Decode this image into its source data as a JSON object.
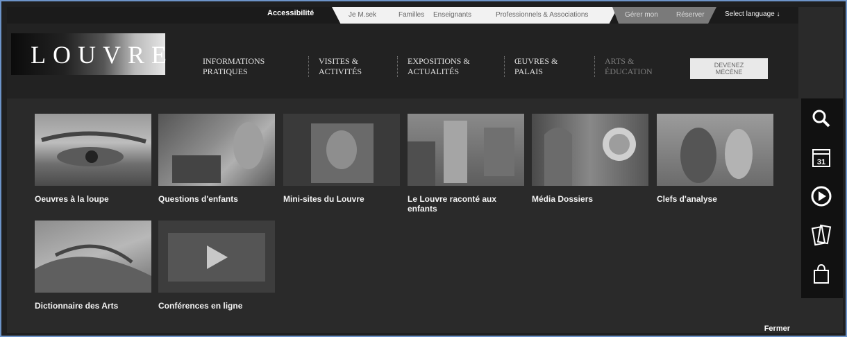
{
  "topbar": {
    "accessibility": "Accessibilité",
    "audiences": [
      "Je M.sek",
      "Familles",
      "Enseignants",
      "Professionnels & Associations"
    ],
    "gray_links": [
      "Gérer mon",
      "Réserver"
    ],
    "language": "Select language ↓"
  },
  "header": {
    "logo": "LOUVRE",
    "nav": [
      {
        "line1": "Informations",
        "line2": "Pratiques"
      },
      {
        "line1": "Visites &",
        "line2": "Activités"
      },
      {
        "line1": "Expositions &",
        "line2": "Actualités"
      },
      {
        "line1": "Œuvres &",
        "line2": "Palais"
      },
      {
        "line1": "Arts &",
        "line2": "Éducation"
      }
    ],
    "donate_line1": "DEVENEZ",
    "donate_line2": "MÉCÈNE"
  },
  "tiles": [
    {
      "caption": "Oeuvres à la loupe"
    },
    {
      "caption": "Questions d'enfants"
    },
    {
      "caption": "Mini-sites du Louvre"
    },
    {
      "caption": "Le Louvre raconté aux enfants"
    },
    {
      "caption": "Média Dossiers"
    },
    {
      "caption": "Clefs d'analyse"
    },
    {
      "caption": "Dictionnaire des Arts"
    },
    {
      "caption": "Conférences en ligne"
    }
  ],
  "close_label": "Fermer",
  "toolbar_icons": [
    "search-icon",
    "calendar-icon",
    "play-icon",
    "tickets-icon",
    "shopping-bag-icon"
  ],
  "calendar_day": "31"
}
